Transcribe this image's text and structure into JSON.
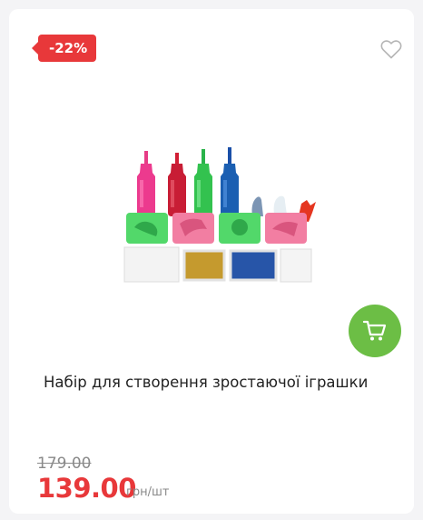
{
  "product": {
    "discount_badge": "-22%",
    "title": "Набір для створення зростаючої іграшки",
    "old_price": "179.00",
    "price": "139.00",
    "unit": "грн/шт",
    "image_alt": "Набір для створення зростаючої іграшки"
  },
  "icons": {
    "wishlist": "heart-outline-icon",
    "cart": "shopping-cart-icon"
  },
  "colors": {
    "badge": "#e8383a",
    "price": "#e8383a",
    "cart_button": "#6cbe45"
  }
}
